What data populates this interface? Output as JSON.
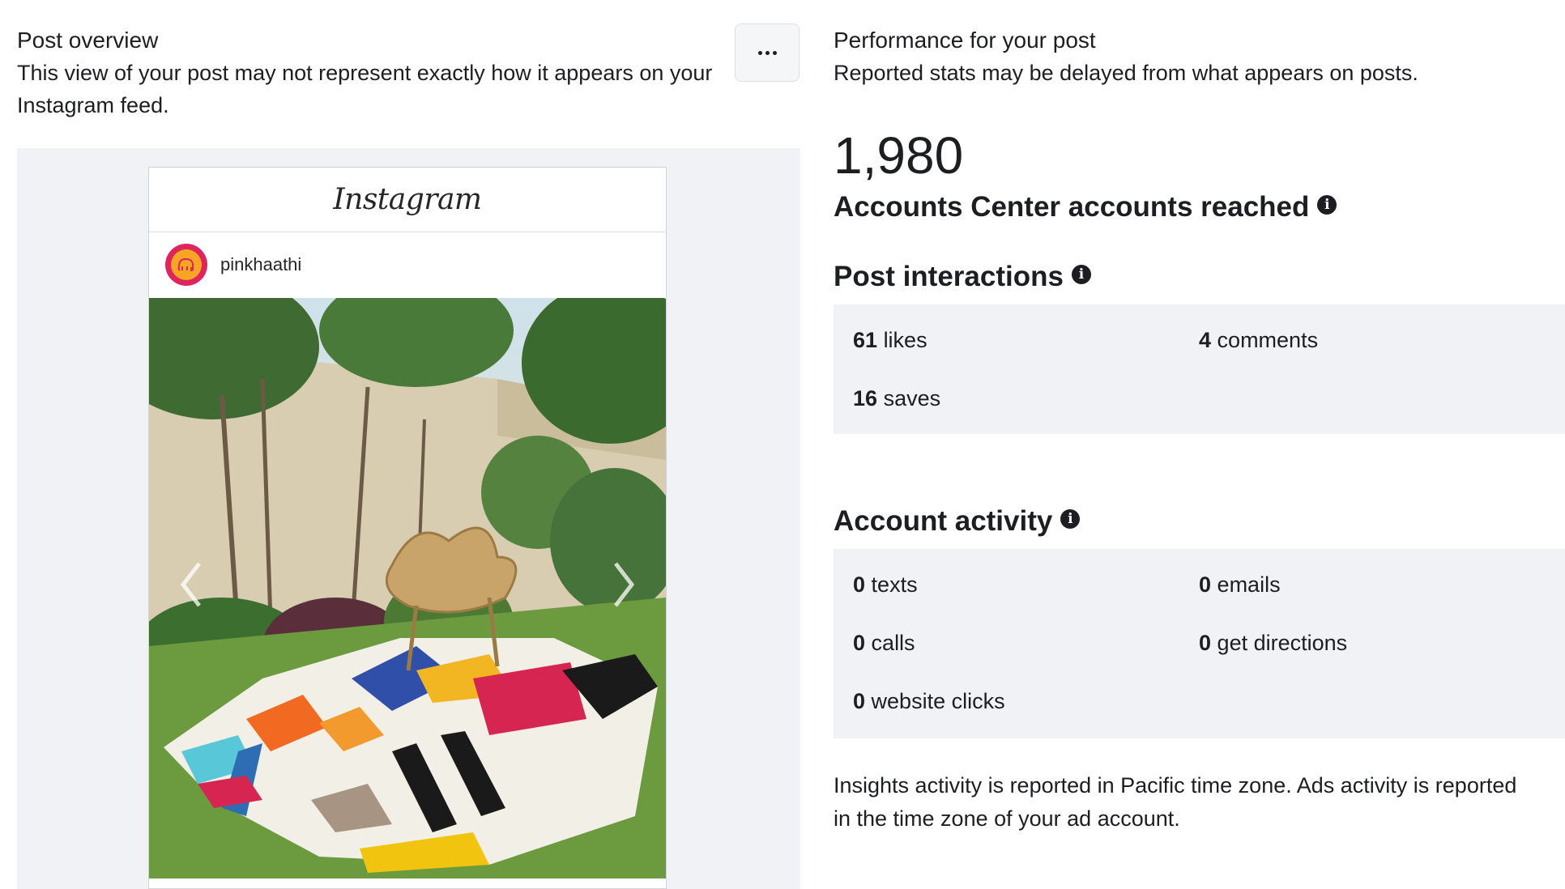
{
  "overview": {
    "title": "Post overview",
    "description": "This view of your post may not represent exactly how it appears on your Instagram feed.",
    "more_icon": "ellipsis-icon"
  },
  "post_preview": {
    "brand": "Instagram",
    "username": "pinkhaathi",
    "prev_icon": "chevron-left-icon",
    "next_icon": "chevron-right-icon"
  },
  "performance": {
    "title": "Performance for your post",
    "description": "Reported stats may be delayed from what appears on posts.",
    "reach_value": "1,980",
    "reach_label": "Accounts Center accounts reached"
  },
  "interactions": {
    "title": "Post interactions",
    "likes_value": "61",
    "likes_label": "likes",
    "comments_value": "4",
    "comments_label": "comments",
    "saves_value": "16",
    "saves_label": "saves"
  },
  "activity": {
    "title": "Account activity",
    "texts_value": "0",
    "texts_label": "texts",
    "emails_value": "0",
    "emails_label": "emails",
    "calls_value": "0",
    "calls_label": "calls",
    "directions_value": "0",
    "directions_label": "get directions",
    "website_value": "0",
    "website_label": "website clicks"
  },
  "footnote": "Insights activity is reported in Pacific time zone. Ads activity is reported in the time zone of your ad account.",
  "colors": {
    "panel_bg": "#f0f2f5",
    "text": "#1c1e21",
    "avatar_ring": "#e0245e",
    "avatar_fill": "#f6a623"
  }
}
